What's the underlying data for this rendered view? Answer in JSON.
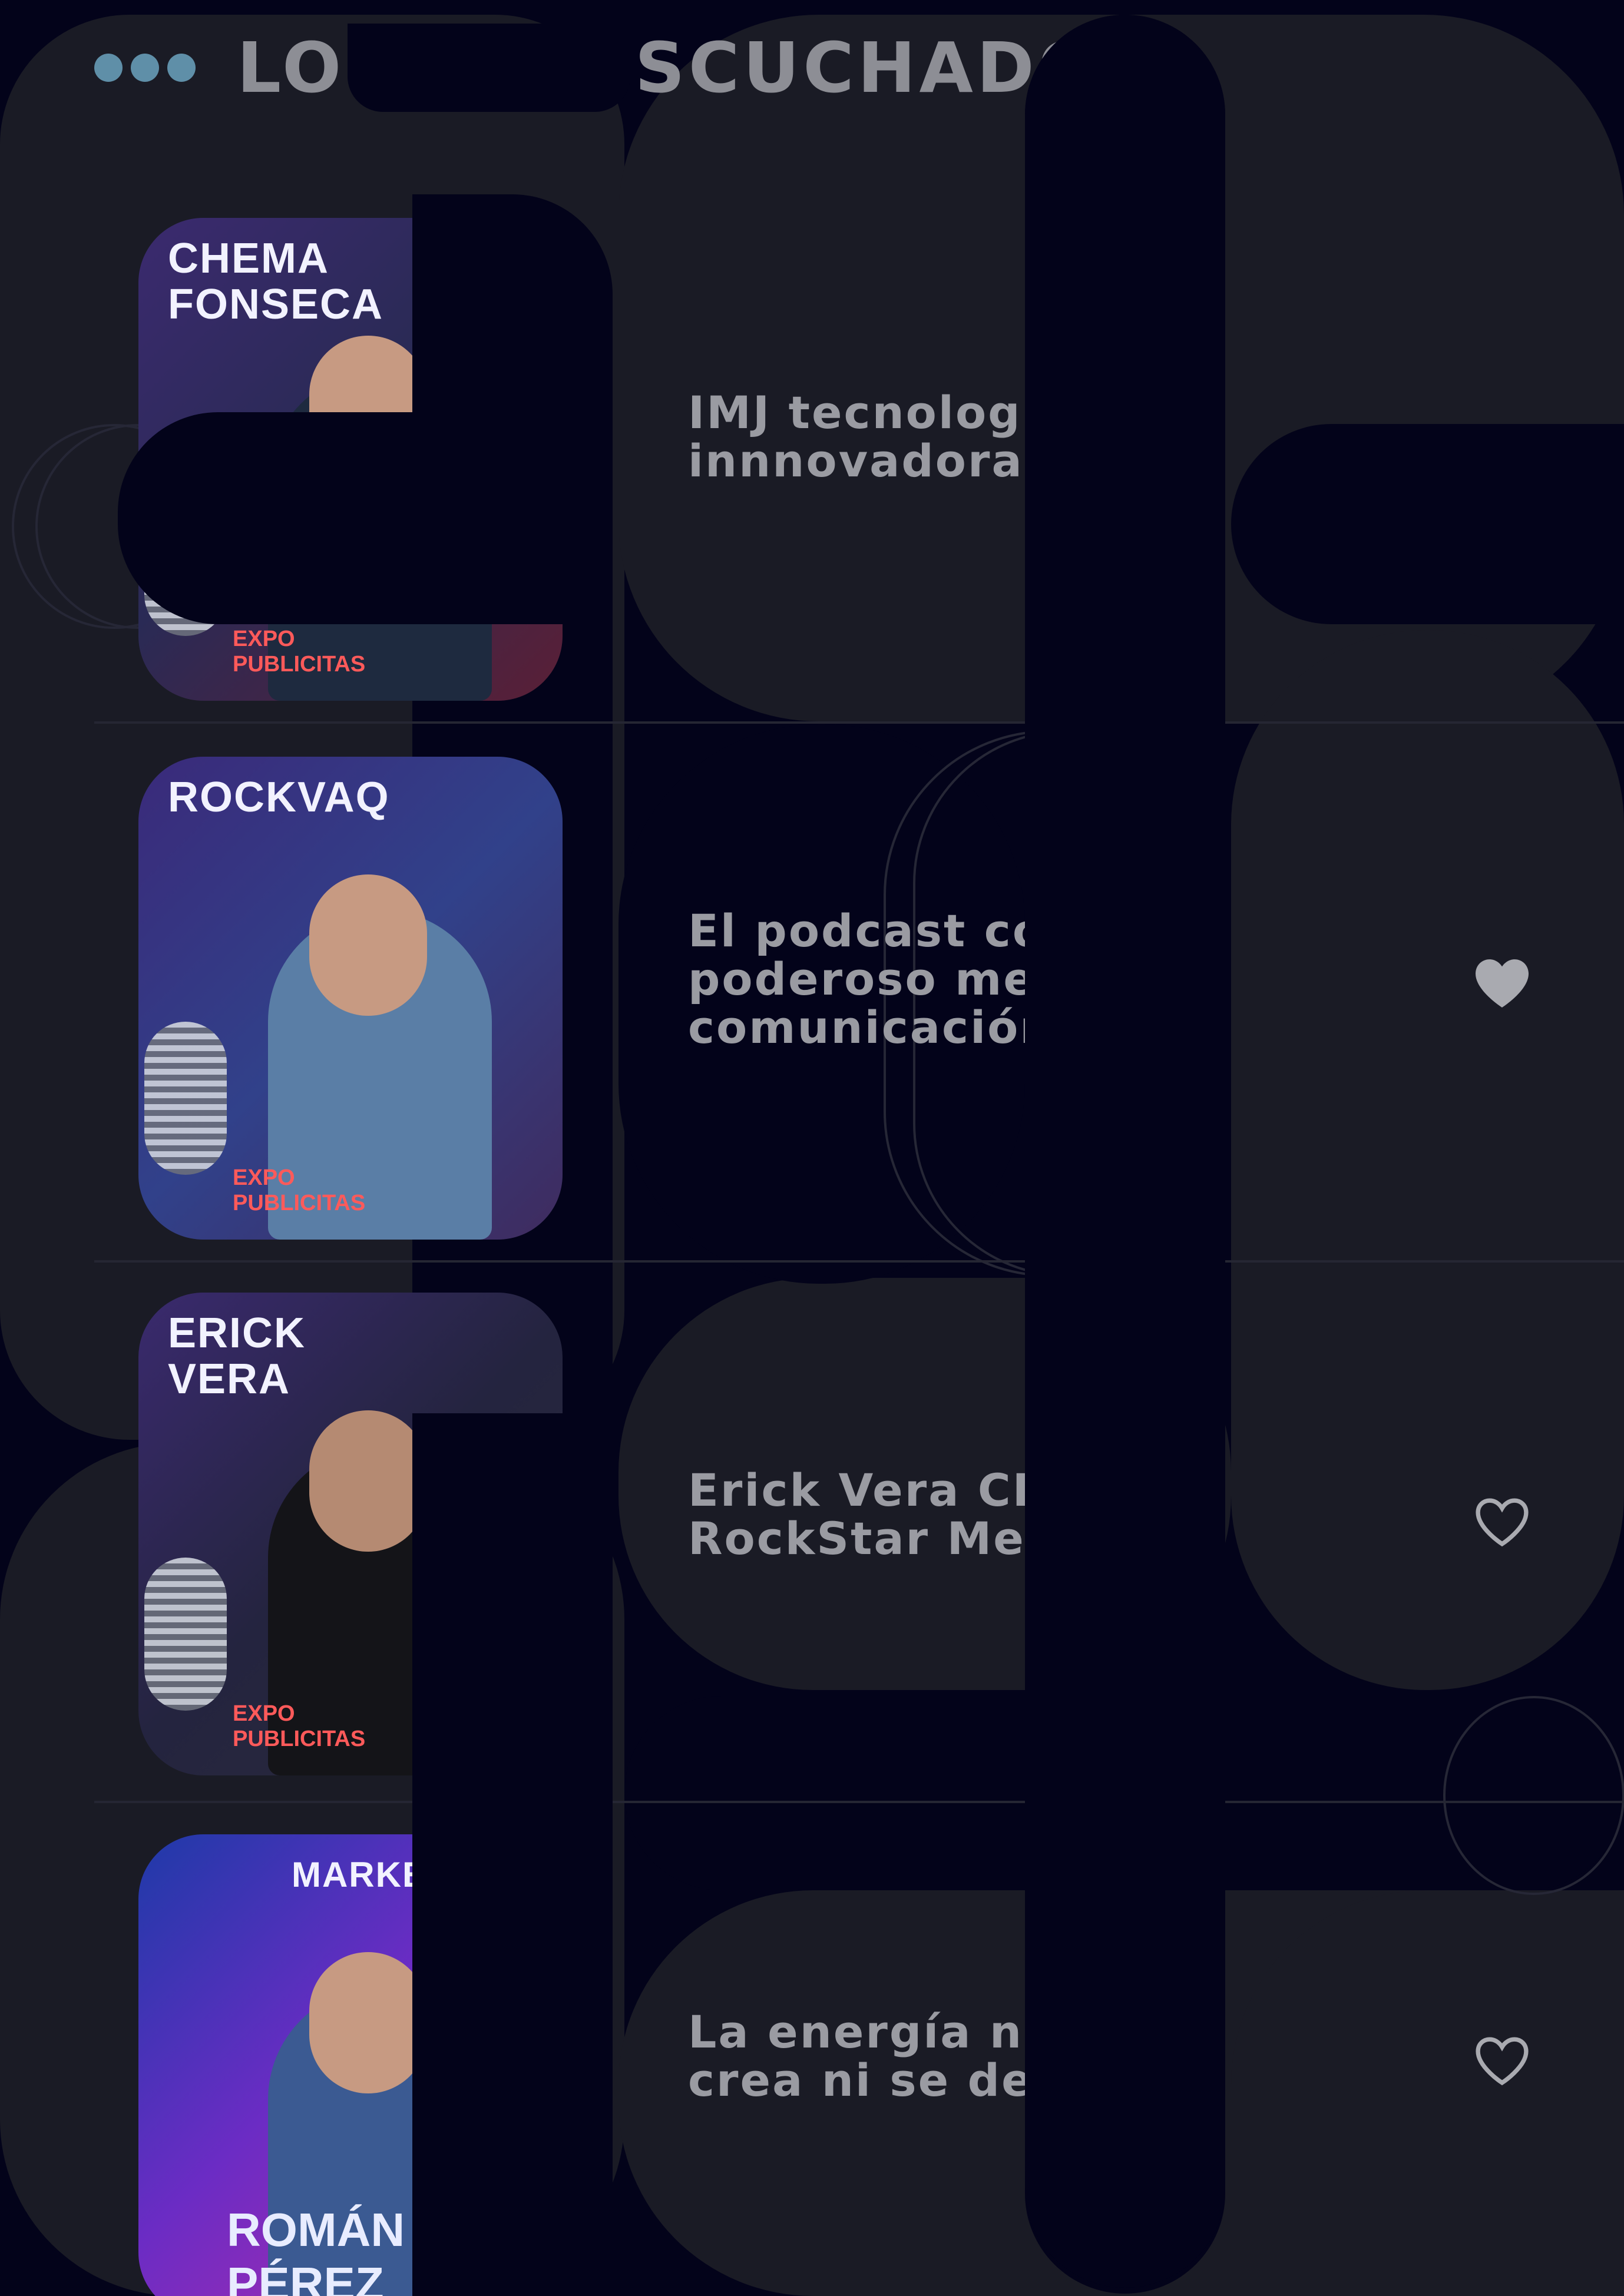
{
  "section": {
    "title": "LO MÁS ESCUCHADO"
  },
  "episodes": [
    {
      "title": "IMJ tecnología\ninnnovadora",
      "thumb_label": "CHEMA\nFONSECA",
      "thumb_logo": "EXPO\nPUBLICITAS",
      "favorited": false,
      "heart_visible": false
    },
    {
      "title": "El podcast com un\npoderoso medio de\ncomunicación",
      "thumb_label": "ROCKVAQ",
      "thumb_logo": "EXPO\nPUBLICITAS",
      "favorited": true,
      "heart_visible": true
    },
    {
      "title": "Erick Vera CEO\nRockStar Media",
      "thumb_label": "ERICK\nVERA",
      "thumb_logo": "EXPO\nPUBLICITAS",
      "favorited": false,
      "heart_visible": true
    },
    {
      "title": "La energía no se\ncrea ni se destruye",
      "thumb_label": "MARKETING",
      "thumb_logo": "ROMÁN PÉREZ",
      "favorited": false,
      "heart_visible": true
    }
  ],
  "colors": {
    "background": "#03031a",
    "card": "#1a1b25",
    "text": "#9a9ba2",
    "accent_dots": "#5f8fa8",
    "heart": "#a9aab0"
  },
  "icons": {
    "menu": "three-dots-icon",
    "favorite": "heart-icon"
  }
}
